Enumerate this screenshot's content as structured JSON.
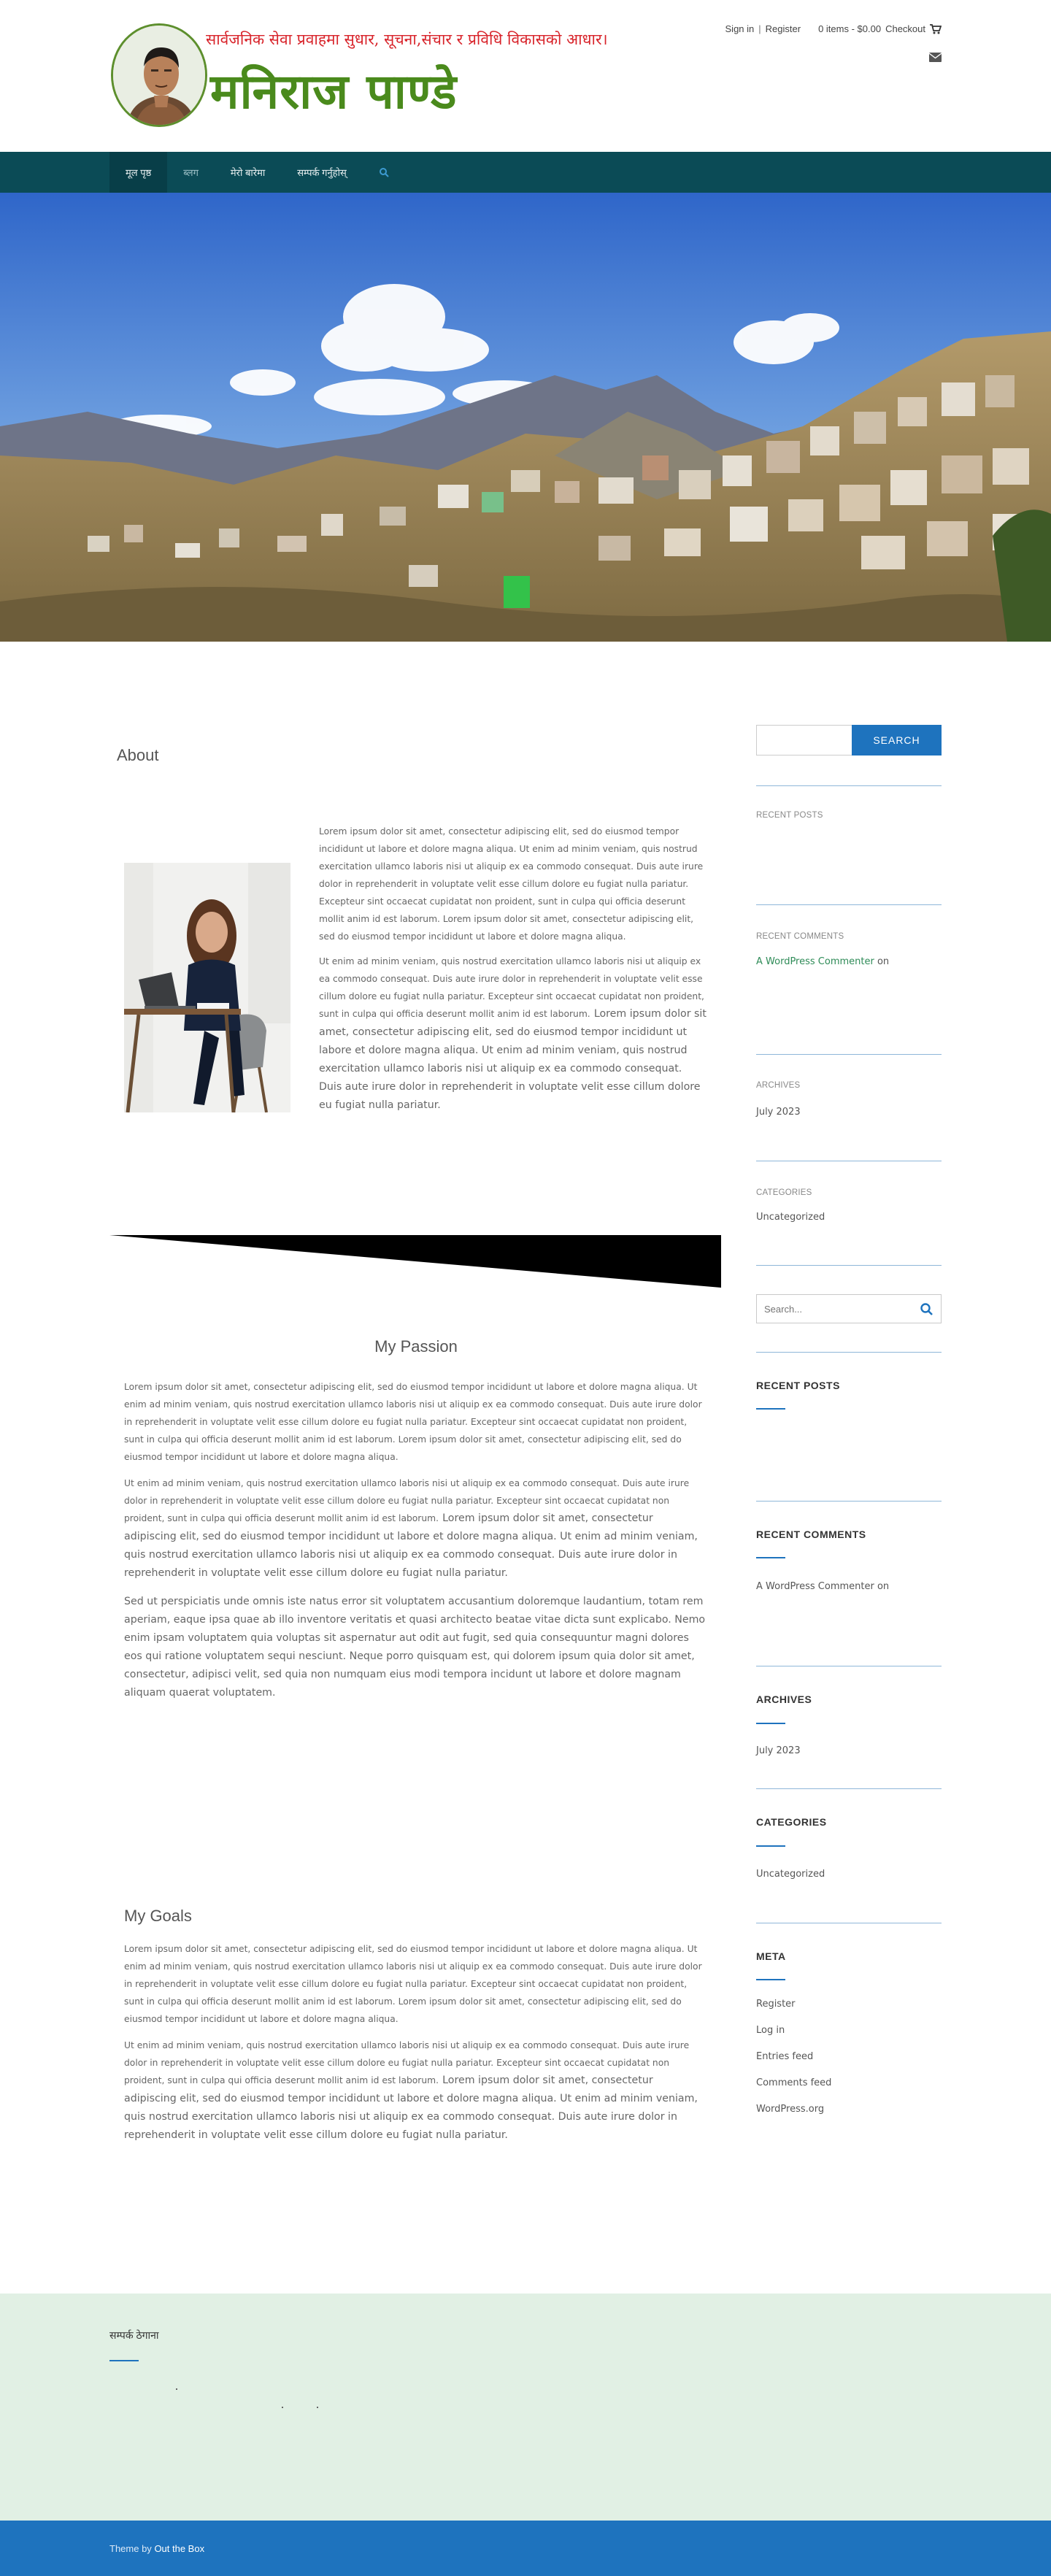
{
  "header": {
    "tagline": "सार्वजनिक सेवा प्रवाहमा सुधार, सूचना,संचार र प्रविधि विकासको आधार।",
    "site_title": "मनिराज पाण्डे",
    "sign_in": "Sign in",
    "separator": "|",
    "register": "Register",
    "cart_summary": "0 items - $0.00",
    "checkout": "Checkout",
    "logo_icon": "portrait-avatar",
    "cart_icon": "shopping-cart-icon",
    "mail_icon": "envelope-icon"
  },
  "nav": {
    "items": [
      {
        "label": "मूल पृष्ठ"
      },
      {
        "label": "ब्लग"
      },
      {
        "label": "मेरो बारेमा"
      },
      {
        "label": "सम्पर्क गर्नुहोस्"
      }
    ],
    "search_icon": "search-icon"
  },
  "colors": {
    "nav_bg": "#0b4b56",
    "accent": "#1e73be",
    "title_green": "#4a8a1c",
    "tagline_red": "#d8232a",
    "footer_bg": "#e1f0e4",
    "link_green": "#2e8b57"
  },
  "about": {
    "title": "About",
    "paragraphs": [
      "Lorem ipsum dolor sit amet, consectetur adipiscing elit, sed do eiusmod tempor incididunt ut labore et dolore magna aliqua. Ut enim ad minim veniam, quis nostrud exercitation ullamco laboris nisi ut aliquip ex ea commodo consequat. Duis aute irure dolor in reprehenderit in voluptate velit esse cillum dolore eu fugiat nulla pariatur. Excepteur sint occaecat cupidatat non proident, sunt in culpa qui officia deserunt mollit anim id est laborum. Lorem ipsum dolor sit amet, consectetur adipiscing elit, sed do eiusmod tempor incididunt ut labore et dolore magna aliqua.",
      "Ut enim ad minim veniam, quis nostrud exercitation ullamco laboris nisi ut aliquip ex ea commodo consequat. Duis aute irure dolor in reprehenderit in voluptate velit esse cillum dolore eu fugiat nulla pariatur. Excepteur sint occaecat cupidatat non proident, sunt in culpa qui officia deserunt mollit anim id est laborum.",
      "Lorem ipsum dolor sit amet, consectetur adipiscing elit, sed do eiusmod tempor incididunt ut labore et dolore magna aliqua. Ut enim ad minim veniam, quis nostrud exercitation ullamco laboris nisi ut aliquip ex ea commodo consequat. Duis aute irure dolor in reprehenderit in voluptate velit esse cillum dolore eu fugiat nulla pariatur."
    ]
  },
  "passion": {
    "title": "My Passion",
    "paragraphs": [
      "Lorem ipsum dolor sit amet, consectetur adipiscing elit, sed do eiusmod tempor incididunt ut labore et dolore magna aliqua. Ut enim ad minim veniam, quis nostrud exercitation ullamco laboris nisi ut aliquip ex ea commodo consequat. Duis aute irure dolor in reprehenderit in voluptate velit esse cillum dolore eu fugiat nulla pariatur. Excepteur sint occaecat cupidatat non proident, sunt in culpa qui officia deserunt mollit anim id est laborum. Lorem ipsum dolor sit amet, consectetur adipiscing elit, sed do eiusmod tempor incididunt ut labore et dolore magna aliqua.",
      "Ut enim ad minim veniam, quis nostrud exercitation ullamco laboris nisi ut aliquip ex ea commodo consequat. Duis aute irure dolor in reprehenderit in voluptate velit esse cillum dolore eu fugiat nulla pariatur. Excepteur sint occaecat cupidatat non proident, sunt in culpa qui officia deserunt mollit anim id est laborum.",
      "Lorem ipsum dolor sit amet, consectetur adipiscing elit, sed do eiusmod tempor incididunt ut labore et dolore magna aliqua. Ut enim ad minim veniam, quis nostrud exercitation ullamco laboris nisi ut aliquip ex ea commodo consequat. Duis aute irure dolor in reprehenderit in voluptate velit esse cillum dolore eu fugiat nulla pariatur.",
      "Sed ut perspiciatis unde omnis iste natus error sit voluptatem accusantium doloremque laudantium, totam rem aperiam, eaque ipsa quae ab illo inventore veritatis et quasi architecto beatae vitae dicta sunt explicabo. Nemo enim ipsam voluptatem quia voluptas sit aspernatur aut odit aut fugit, sed quia consequuntur magni dolores eos qui ratione voluptatem sequi nesciunt. Neque porro quisquam est, qui dolorem ipsum quia dolor sit amet, consectetur, adipisci velit, sed quia non numquam eius modi tempora incidunt ut labore et dolore magnam aliquam quaerat voluptatem."
    ]
  },
  "goals": {
    "title": "My Goals",
    "paragraphs": [
      "Lorem ipsum dolor sit amet, consectetur adipiscing elit, sed do eiusmod tempor incididunt ut labore et dolore magna aliqua. Ut enim ad minim veniam, quis nostrud exercitation ullamco laboris nisi ut aliquip ex ea commodo consequat. Duis aute irure dolor in reprehenderit in voluptate velit esse cillum dolore eu fugiat nulla pariatur. Excepteur sint occaecat cupidatat non proident, sunt in culpa qui officia deserunt mollit anim id est laborum. Lorem ipsum dolor sit amet, consectetur adipiscing elit, sed do eiusmod tempor incididunt ut labore et dolore magna aliqua.",
      "Ut enim ad minim veniam, quis nostrud exercitation ullamco laboris nisi ut aliquip ex ea commodo consequat. Duis aute irure dolor in reprehenderit in voluptate velit esse cillum dolore eu fugiat nulla pariatur. Excepteur sint occaecat cupidatat non proident, sunt in culpa qui officia deserunt mollit anim id est laborum.",
      "Lorem ipsum dolor sit amet, consectetur adipiscing elit, sed do eiusmod tempor incididunt ut labore et dolore magna aliqua. Ut enim ad minim veniam, quis nostrud exercitation ullamco laboris nisi ut aliquip ex ea commodo consequat. Duis aute irure dolor in reprehenderit in voluptate velit esse cillum dolore eu fugiat nulla pariatur."
    ]
  },
  "sidebar": {
    "search_button": "SEARCH",
    "search_value": "",
    "recent_posts_small": "RECENT POSTS",
    "recent_comments_small": "RECENT COMMENTS",
    "commenter": "A WordPress Commenter",
    "comment_on": "on",
    "archives_small": "ARCHIVES",
    "archive_month": "July 2023",
    "categories_small": "CATEGORIES",
    "category": "Uncategorized",
    "search2_placeholder": "Search...",
    "search2_icon": "search-icon",
    "recent_posts_title": "RECENT POSTS",
    "recent_comments_title": "RECENT COMMENTS",
    "archives_title": "ARCHIVES",
    "categories_title": "CATEGORIES",
    "meta_title": "META",
    "meta_links": [
      {
        "label": "Register"
      },
      {
        "label": "Log in"
      },
      {
        "label": "Entries feed"
      },
      {
        "label": "Comments feed"
      },
      {
        "label": "WordPress.org"
      }
    ]
  },
  "footer": {
    "widget_title": "सम्पर्क ठेगाना",
    "credit_prefix": "Theme by",
    "credit_link": "Out the Box"
  }
}
